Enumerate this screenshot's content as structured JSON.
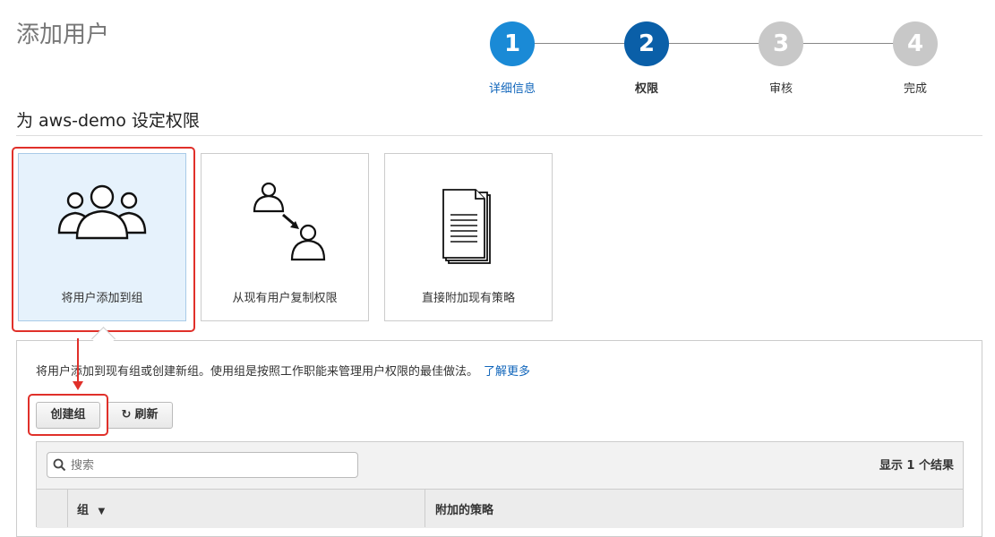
{
  "page": {
    "title": "添加用户"
  },
  "stepper": {
    "steps": [
      {
        "number": "1",
        "label": "详细信息",
        "state": "done"
      },
      {
        "number": "2",
        "label": "权限",
        "state": "active"
      },
      {
        "number": "3",
        "label": "审核",
        "state": "pending"
      },
      {
        "number": "4",
        "label": "完成",
        "state": "pending"
      }
    ]
  },
  "section": {
    "title": "为 aws-demo 设定权限"
  },
  "options": [
    {
      "label": "将用户添加到组",
      "icon": "user-group-icon",
      "selected": true
    },
    {
      "label": "从现有用户复制权限",
      "icon": "copy-user-permissions-icon",
      "selected": false
    },
    {
      "label": "直接附加现有策略",
      "icon": "policy-document-icon",
      "selected": false
    }
  ],
  "panel": {
    "description": "将用户添加到现有组或创建新组。使用组是按照工作职能来管理用户权限的最佳做法。",
    "learn_more": "了解更多",
    "create_group_button": "创建组",
    "refresh_button": "刷新",
    "search_placeholder": "搜索",
    "result_count": "显示 1 个结果",
    "columns": {
      "group": "组",
      "attached_policies": "附加的策略"
    }
  },
  "colors": {
    "step_done": "#1a8ad6",
    "step_active": "#0a5fa8",
    "step_pending": "#c8c8c8",
    "highlight": "#e0302a",
    "link": "#1166bb"
  }
}
